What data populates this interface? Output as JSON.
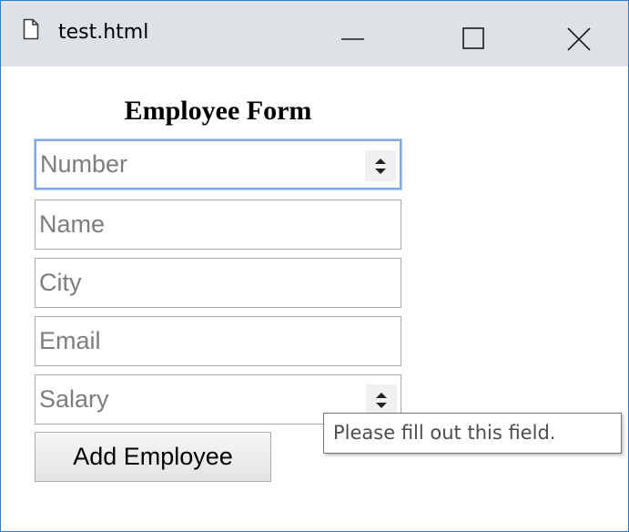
{
  "window": {
    "title": "test.html",
    "tab_icon": "document-icon",
    "controls": [
      "minimize-icon",
      "maximize-icon",
      "close-icon"
    ]
  },
  "form": {
    "heading": "Employee Form",
    "fields": {
      "number": {
        "placeholder": "Number",
        "value": "",
        "type": "number",
        "focused": true
      },
      "name": {
        "placeholder": "Name",
        "value": "",
        "type": "text"
      },
      "city": {
        "placeholder": "City",
        "value": "",
        "type": "text"
      },
      "email": {
        "placeholder": "Email",
        "value": "",
        "type": "text"
      },
      "salary": {
        "placeholder": "Salary",
        "value": "",
        "type": "number"
      }
    },
    "submit_label": "Add Employee"
  },
  "tooltip": {
    "text": "Please fill out this field."
  },
  "colors": {
    "titlebar_bg": "#dee1e6",
    "window_border": "#2f7fd0",
    "focus_ring": "#7fa9e6",
    "placeholder": "#7d7d7d"
  }
}
